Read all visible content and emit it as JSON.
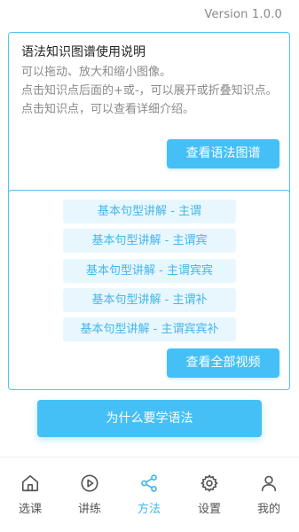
{
  "version": "Version 1.0.0",
  "intro": {
    "title": "语法知识图谱使用说明",
    "lines": [
      "可以拖动、放大和缩小图像。",
      "点击知识点后面的+或-，可以展开或折叠知识点。",
      "点击知识点，可以查看详细介绍。"
    ],
    "button": "查看语法图谱"
  },
  "lessons": {
    "items": [
      "基本句型讲解 - 主谓",
      "基本句型讲解 - 主谓宾",
      "基本句型讲解 - 主谓宾宾",
      "基本句型讲解 - 主谓补",
      "基本句型讲解 - 主谓宾宾补"
    ],
    "button": "查看全部视频"
  },
  "why_button": "为什么要学语法",
  "tabs": [
    {
      "label": "选课",
      "icon": "home-icon",
      "active": false
    },
    {
      "label": "讲练",
      "icon": "play-icon",
      "active": false
    },
    {
      "label": "方法",
      "icon": "share-icon",
      "active": true
    },
    {
      "label": "设置",
      "icon": "gear-icon",
      "active": false
    },
    {
      "label": "我的",
      "icon": "user-icon",
      "active": false
    }
  ],
  "colors": {
    "accent": "#45c0f6",
    "border": "#4cc4f4",
    "lesson_bg": "#e8f7fe",
    "lesson_text": "#45b6ea"
  }
}
